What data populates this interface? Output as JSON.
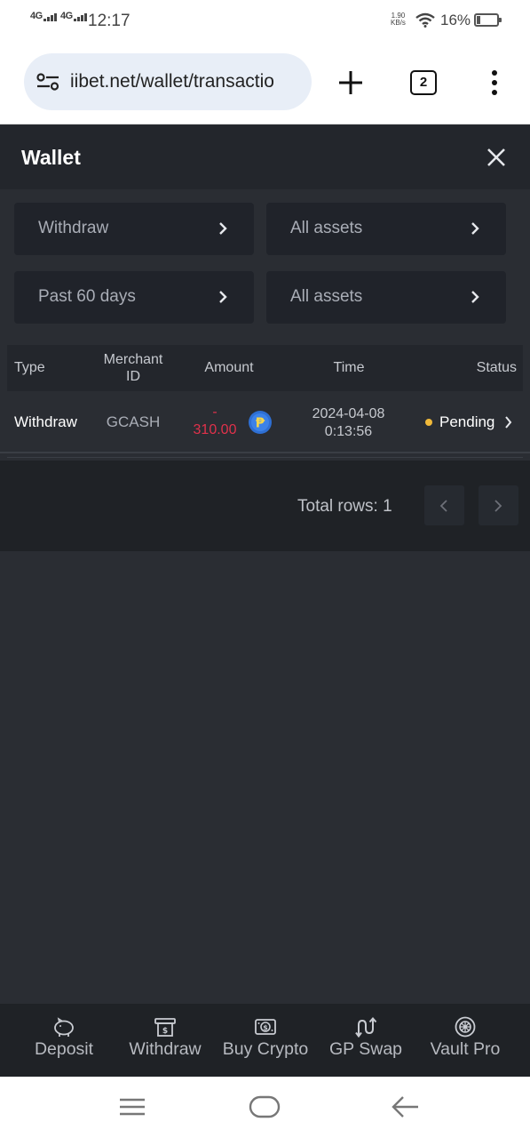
{
  "status_bar": {
    "network1": "4G",
    "network2": "4G",
    "time": "12:17",
    "speed_value": "1.90",
    "speed_unit": "KB/s",
    "battery": "16%"
  },
  "browser": {
    "url": "iibet.net/wallet/transactio",
    "tab_count": "2"
  },
  "wallet": {
    "title": "Wallet",
    "filters": {
      "type": "Withdraw",
      "assets1": "All assets",
      "period": "Past 60 days",
      "assets2": "All assets"
    },
    "table": {
      "headers": {
        "type": "Type",
        "merchant_id_line1": "Merchant",
        "merchant_id_line2": "ID",
        "amount": "Amount",
        "time": "Time",
        "status": "Status"
      },
      "rows": [
        {
          "type": "Withdraw",
          "merchant_id": "GCASH",
          "amount_sign": "-",
          "amount": "310.00",
          "currency_icon": "peso-coin-icon",
          "date": "2024-04-08",
          "time": "0:13:56",
          "status": "Pending"
        }
      ]
    },
    "pagination": {
      "total_rows": "Total rows: 1"
    }
  },
  "bottom_nav": {
    "items": [
      {
        "label": "Deposit",
        "icon": "piggy-bank-icon"
      },
      {
        "label": "Withdraw",
        "icon": "withdraw-icon"
      },
      {
        "label": "Buy Crypto",
        "icon": "banknote-icon"
      },
      {
        "label": "GP Swap",
        "icon": "swap-icon"
      },
      {
        "label": "Vault Pro",
        "icon": "vault-icon"
      }
    ]
  },
  "colors": {
    "negative_amount": "#e0314b",
    "pending_dot": "#f0b93a",
    "peso_coin": "#2e6fd4"
  }
}
